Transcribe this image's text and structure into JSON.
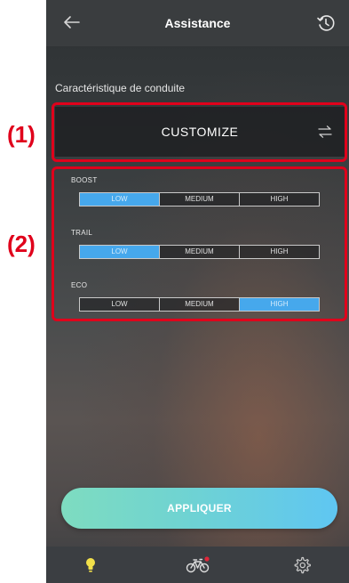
{
  "header": {
    "title": "Assistance",
    "back_icon": "back-arrow-icon",
    "history_icon": "history-icon"
  },
  "section_label": "Caractéristique de conduite",
  "mode": {
    "value": "CUSTOMIZE",
    "icon": "swap-icon"
  },
  "groups": [
    {
      "label": "BOOST",
      "options": [
        "LOW",
        "MEDIUM",
        "HIGH"
      ],
      "selected": "LOW"
    },
    {
      "label": "TRAIL",
      "options": [
        "LOW",
        "MEDIUM",
        "HIGH"
      ],
      "selected": "LOW"
    },
    {
      "label": "ECO",
      "options": [
        "LOW",
        "MEDIUM",
        "HIGH"
      ],
      "selected": "HIGH"
    }
  ],
  "apply_button": {
    "label": "APPLIQUER"
  },
  "bottom_nav": {
    "items": [
      {
        "icon": "lightbulb-icon",
        "active": true
      },
      {
        "icon": "bicycle-icon",
        "notification": true
      },
      {
        "icon": "gear-icon"
      }
    ]
  },
  "annotations": [
    "(1)",
    "(2)"
  ],
  "colors": {
    "accent": "#46a8ec",
    "annotation": "#e0001b",
    "active_nav": "#f2e04a",
    "notification_dot": "#e0263a",
    "apply_gradient_start": "#7edcc0",
    "apply_gradient_end": "#5fc6f2"
  }
}
